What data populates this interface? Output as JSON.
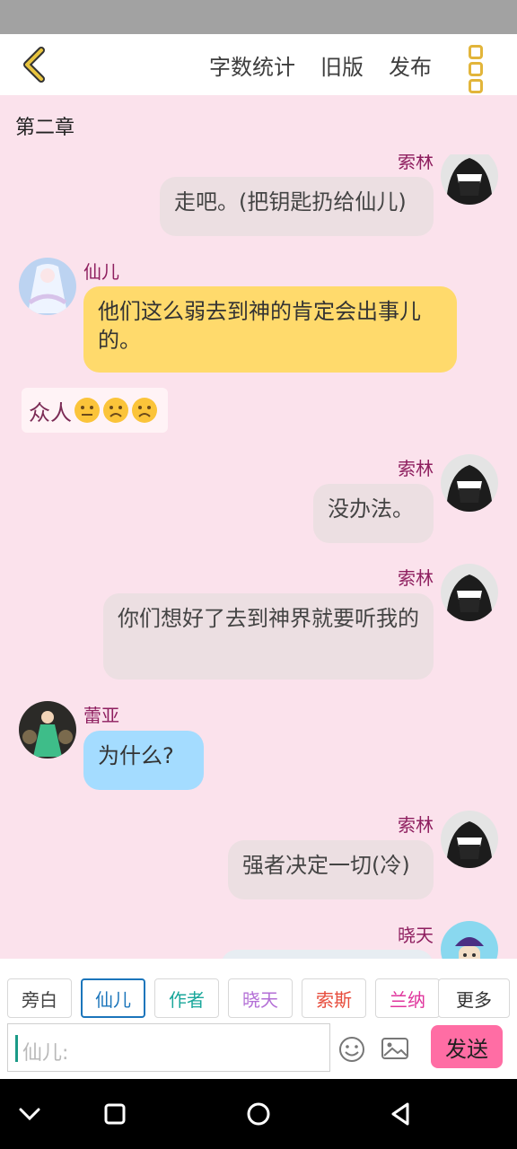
{
  "header": {
    "word_count": "字数统计",
    "old_version": "旧版",
    "publish": "发布"
  },
  "chapter_title": "第二章",
  "messages": [
    {
      "speaker": "索林",
      "text": "走吧。(把钥匙扔给仙儿)"
    },
    {
      "speaker": "仙儿",
      "text": "他们这么弱去到神的肯定会出事儿的。"
    },
    {
      "speaker": "",
      "text": "众人"
    },
    {
      "speaker": "索林",
      "text": "没办法。"
    },
    {
      "speaker": "索林",
      "text": "你们想好了去到神界就要听我的"
    },
    {
      "speaker": "蕾亚",
      "text": "为什么?"
    },
    {
      "speaker": "索林",
      "text": "强者决定一切(冷)"
    },
    {
      "speaker": "晓天",
      "text": ""
    }
  ],
  "roles": [
    "旁白",
    "仙儿",
    "作者",
    "晓天",
    "索斯",
    "兰纳",
    "更多"
  ],
  "role_colors": [
    "#444444",
    "#1b75bb",
    "#1aa79b",
    "#b36fd6",
    "#e74c3c",
    "#e0349c",
    "#333333"
  ],
  "input": {
    "placeholder": "仙儿:"
  },
  "send_label": "发送"
}
